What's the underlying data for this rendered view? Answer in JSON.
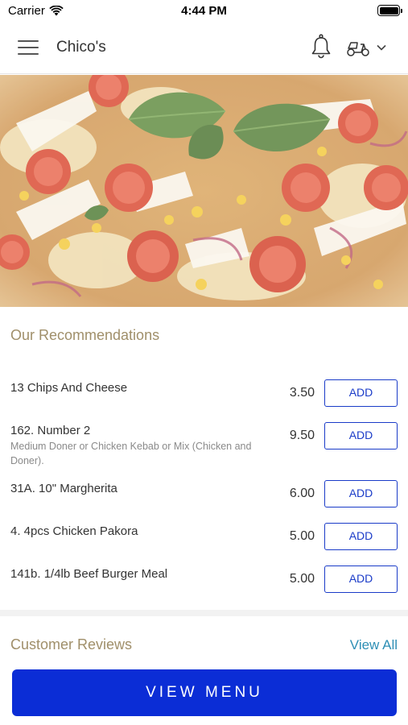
{
  "status_bar": {
    "carrier": "Carrier",
    "time": "4:44 PM",
    "wifi_icon": "wifi-icon",
    "battery_icon": "battery-full-icon"
  },
  "header": {
    "title": "Chico's",
    "menu_icon": "hamburger-menu-icon",
    "notification_icon": "bell-icon",
    "delivery_icon": "scooter-icon",
    "dropdown_icon": "chevron-down-icon"
  },
  "hero": {
    "image": "pizza-photo"
  },
  "recommendations": {
    "title": "Our Recommendations",
    "add_label": "ADD",
    "items": [
      {
        "name": "13 Chips And Cheese",
        "description": "",
        "price": "3.50"
      },
      {
        "name": "162. Number 2",
        "description": "Medium Doner or Chicken Kebab or Mix (Chicken and Doner).",
        "price": "9.50"
      },
      {
        "name": "31A. 10\" Margherita",
        "description": "",
        "price": "6.00"
      },
      {
        "name": "4. 4pcs Chicken Pakora",
        "description": "",
        "price": "5.00"
      },
      {
        "name": "141b. 1/4lb Beef Burger Meal",
        "description": "",
        "price": "5.00"
      }
    ]
  },
  "reviews": {
    "title": "Customer Reviews",
    "view_all": "View All"
  },
  "footer": {
    "view_menu": "VIEW MENU"
  },
  "colors": {
    "accent_blue": "#0b2dd6",
    "section_title": "#a08f6a",
    "link": "#2e8fb5"
  }
}
